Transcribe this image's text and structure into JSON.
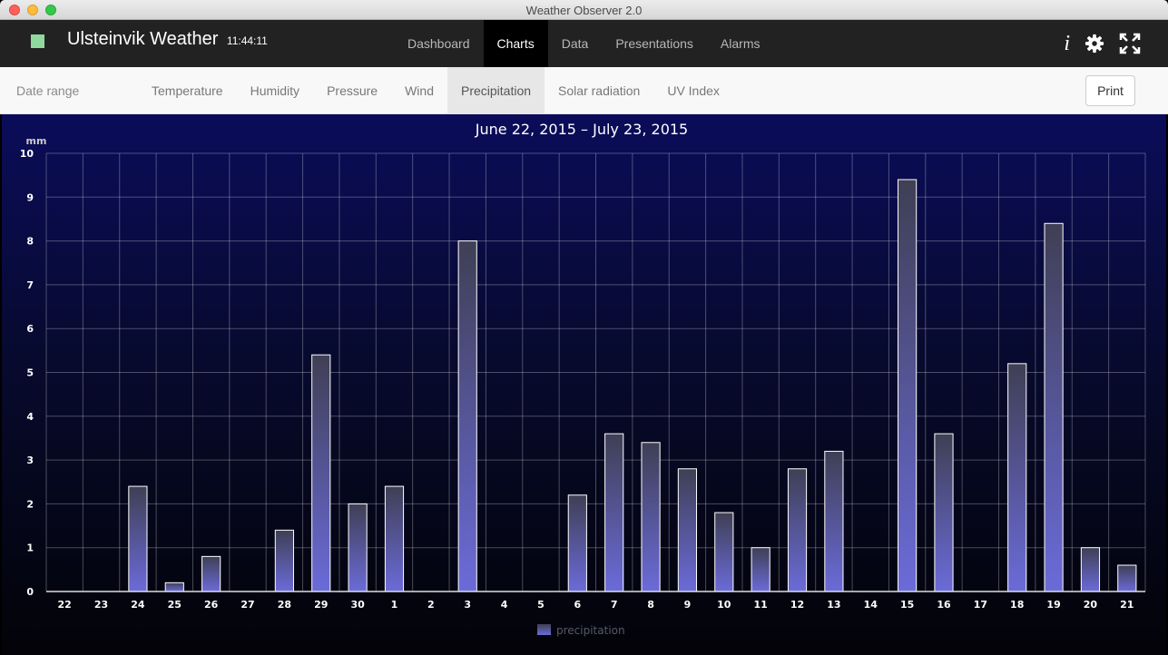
{
  "window": {
    "title": "Weather Observer 2.0"
  },
  "navbar": {
    "brand": "Ulsteinvik Weather",
    "time": "11:44:11",
    "links": [
      "Dashboard",
      "Charts",
      "Data",
      "Presentations",
      "Alarms"
    ],
    "active": "Charts",
    "status_color": "#8fd99c",
    "icons": [
      "info-icon",
      "gear-icon",
      "fullscreen-icon"
    ]
  },
  "subnav": {
    "date_range_label": "Date range",
    "tabs": [
      "Temperature",
      "Humidity",
      "Pressure",
      "Wind",
      "Precipitation",
      "Solar radiation",
      "UV Index"
    ],
    "active": "Precipitation",
    "print_label": "Print"
  },
  "chart_data": {
    "type": "bar",
    "title": "June 22, 2015 – July 23, 2015",
    "ylabel": "mm",
    "ylim": [
      0,
      10
    ],
    "yticks": [
      0,
      1,
      2,
      3,
      4,
      5,
      6,
      7,
      8,
      9,
      10
    ],
    "grid": true,
    "legend_position": "bottom-center",
    "bar_color": "#6b6bd9",
    "categories": [
      "22",
      "23",
      "24",
      "25",
      "26",
      "27",
      "28",
      "29",
      "30",
      "1",
      "2",
      "3",
      "4",
      "5",
      "6",
      "7",
      "8",
      "9",
      "10",
      "11",
      "12",
      "13",
      "14",
      "15",
      "16",
      "17",
      "18",
      "19",
      "20",
      "21"
    ],
    "series": [
      {
        "name": "precipitation",
        "values": [
          0,
          0,
          2.4,
          0.2,
          0.8,
          0,
          1.4,
          5.4,
          2.0,
          2.4,
          0,
          8.0,
          0,
          0,
          2.2,
          3.6,
          3.4,
          2.8,
          1.8,
          1.0,
          2.8,
          3.2,
          0,
          9.4,
          3.6,
          0,
          5.2,
          8.4,
          1.0,
          0.6
        ]
      }
    ]
  }
}
